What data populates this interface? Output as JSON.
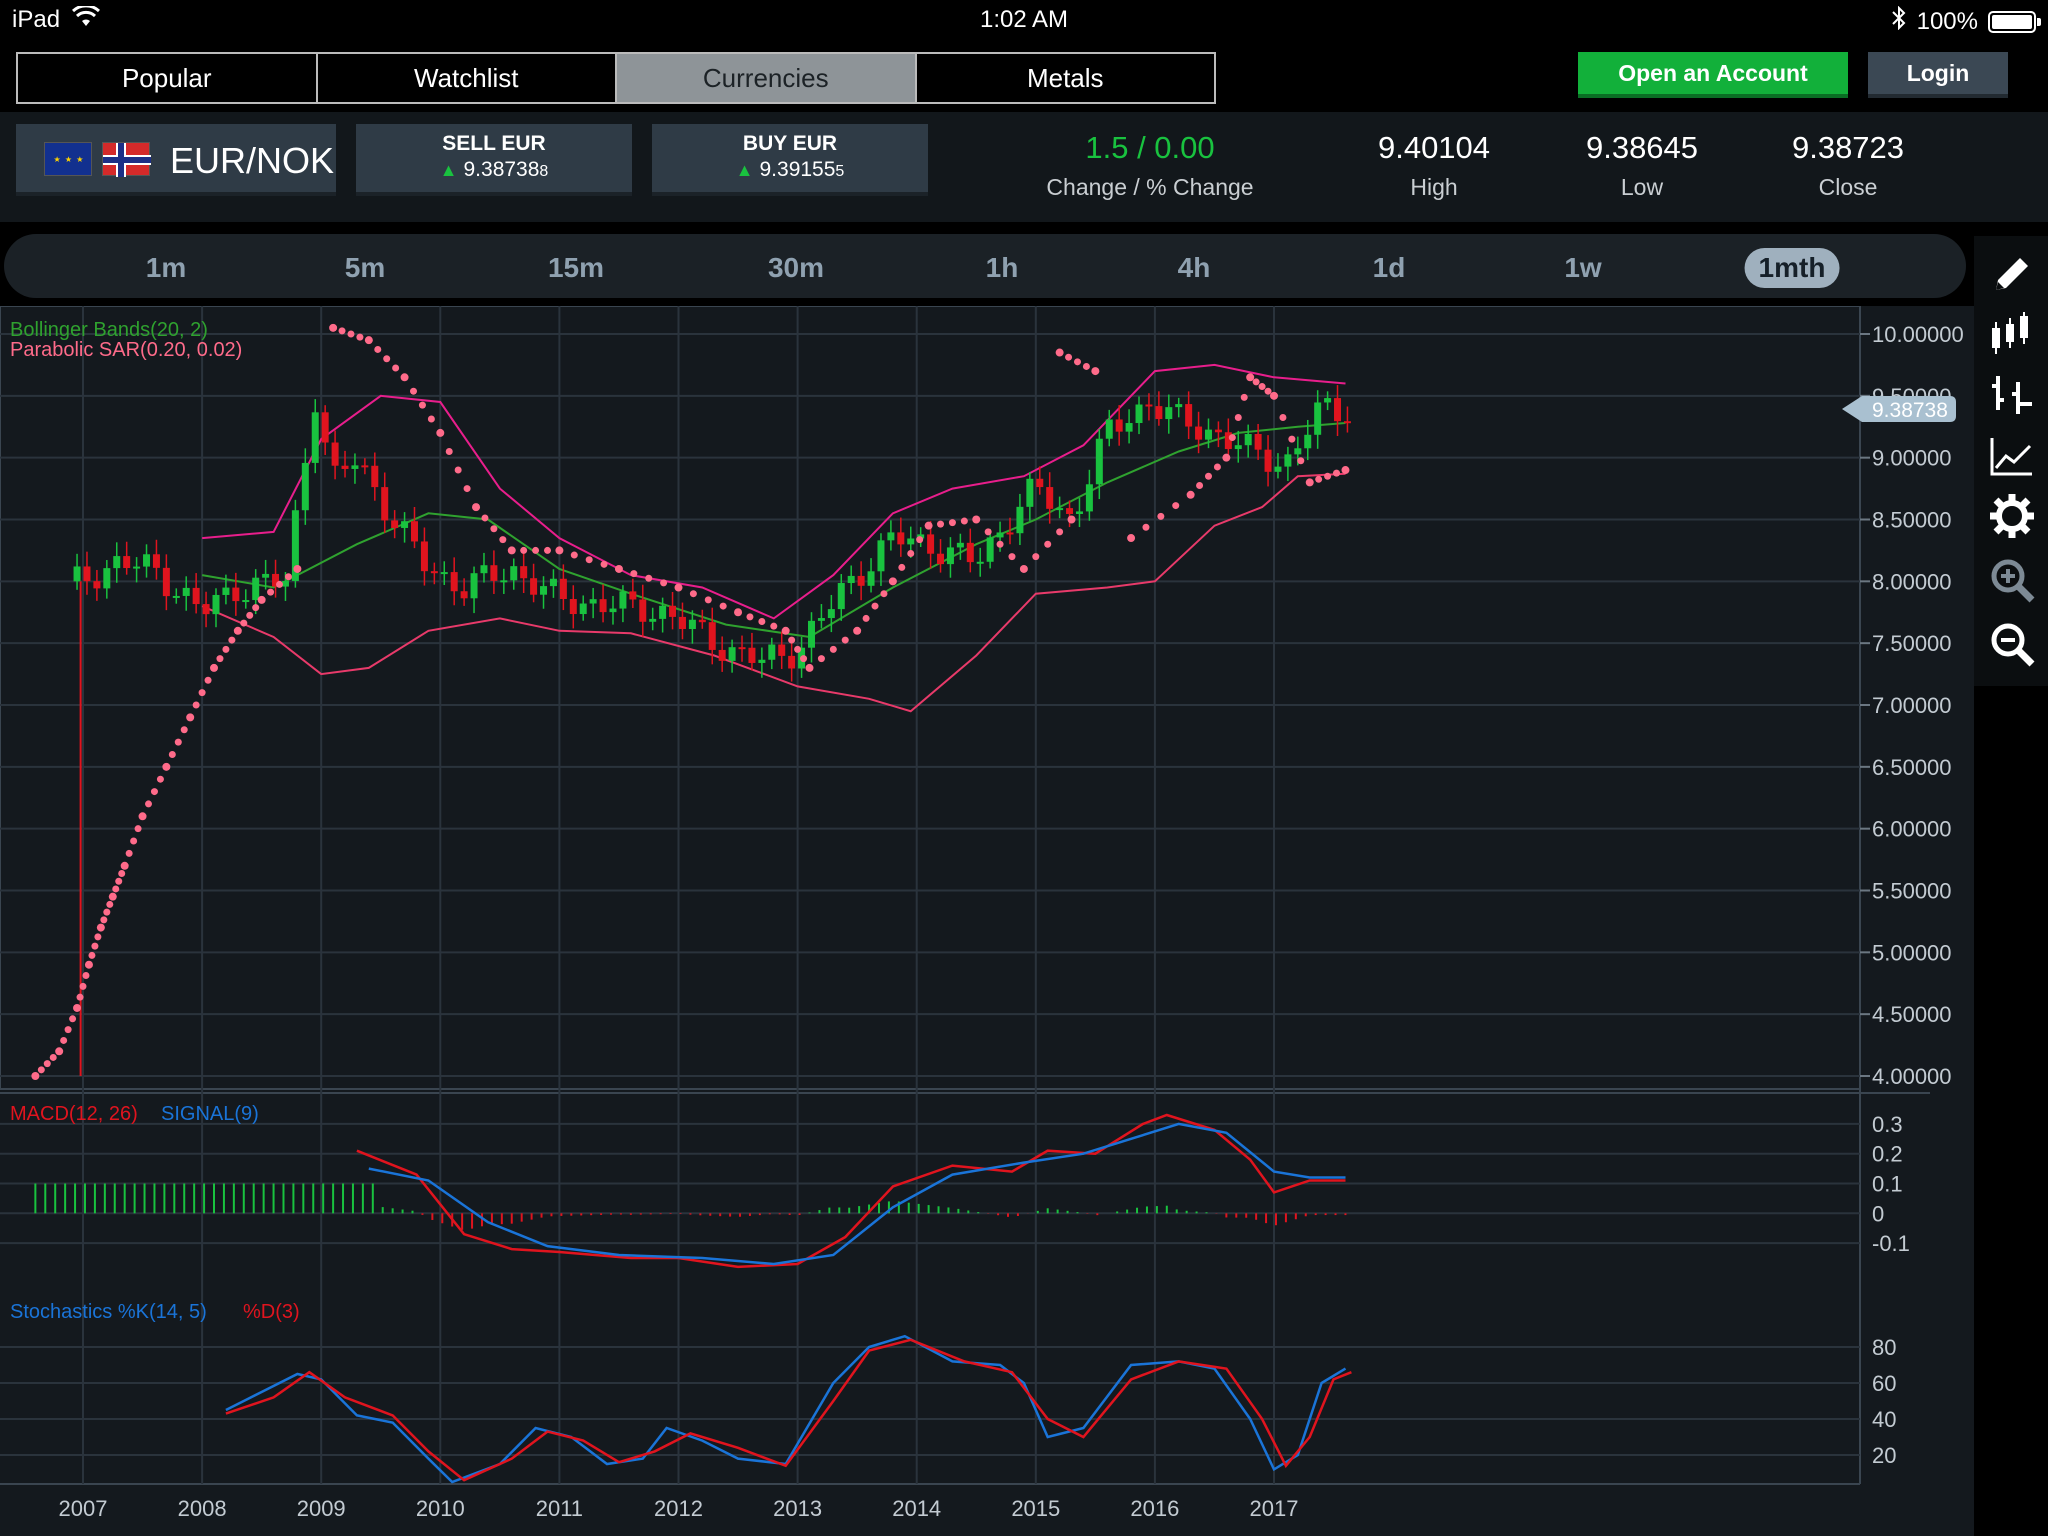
{
  "status_bar": {
    "device": "iPad",
    "time": "1:02 AM",
    "battery": "100%",
    "battery_level": 1.0
  },
  "tabs": [
    {
      "label": "Popular",
      "active": false
    },
    {
      "label": "Watchlist",
      "active": false
    },
    {
      "label": "Currencies",
      "active": true
    },
    {
      "label": "Metals",
      "active": false
    }
  ],
  "actions": {
    "open_account": "Open an Account",
    "login": "Login"
  },
  "instrument": {
    "pair": "EUR/NOK",
    "sell_label": "SELL EUR",
    "sell_price_main": "9.38738",
    "sell_price_sub": "8",
    "buy_label": "BUY EUR",
    "buy_price_main": "9.39155",
    "buy_price_sub": "5",
    "change": "1.5 / 0.00",
    "change_label": "Change / % Change",
    "high": "9.40104",
    "high_label": "High",
    "low": "9.38645",
    "low_label": "Low",
    "close": "9.38723",
    "close_label": "Close"
  },
  "timeframes": [
    {
      "label": "1m",
      "active": false
    },
    {
      "label": "5m",
      "active": false
    },
    {
      "label": "15m",
      "active": false
    },
    {
      "label": "30m",
      "active": false
    },
    {
      "label": "1h",
      "active": false
    },
    {
      "label": "4h",
      "active": false
    },
    {
      "label": "1d",
      "active": false
    },
    {
      "label": "1w",
      "active": false
    },
    {
      "label": "1mth",
      "active": true
    }
  ],
  "toolbar_icons": [
    "pencil-icon",
    "candlestick-icon",
    "ohlc-bars-icon",
    "line-chart-icon",
    "gear-icon",
    "zoom-in-icon",
    "zoom-out-icon"
  ],
  "colors": {
    "up": "#19c23f",
    "down": "#e0141e",
    "band_outer": "#e81e8c",
    "band_lower": "#e83a6a",
    "band_mid": "#2fa22f",
    "sar": "#ff6b8a",
    "macd": "#e0141e",
    "signal": "#1a74d8",
    "accent_green": "#12b03a"
  },
  "chart_data": [
    {
      "type": "candlestick",
      "indicators": [
        "Bollinger Bands(20, 2)",
        "Parabolic SAR(0.20, 0.02)"
      ],
      "current_price": "9.38738",
      "yticks": [
        "10.00000",
        "9.50000",
        "9.00000",
        "8.50000",
        "8.00000",
        "7.50000",
        "7.00000",
        "6.50000",
        "6.00000",
        "5.50000",
        "5.00000",
        "4.50000",
        "4.00000"
      ],
      "ylim": [
        4.0,
        10.0
      ],
      "x_ticks": [
        "2007",
        "2008",
        "2009",
        "2010",
        "2011",
        "2012",
        "2013",
        "2014",
        "2015",
        "2016",
        "2017"
      ],
      "close_series": [
        {
          "x": 2006.95,
          "y": 8.0
        },
        {
          "x": 2007.3,
          "y": 8.15
        },
        {
          "x": 2007.6,
          "y": 8.1
        },
        {
          "x": 2008.0,
          "y": 7.75
        },
        {
          "x": 2008.3,
          "y": 7.95
        },
        {
          "x": 2008.7,
          "y": 8.0
        },
        {
          "x": 2008.95,
          "y": 9.5
        },
        {
          "x": 2009.1,
          "y": 8.8
        },
        {
          "x": 2009.3,
          "y": 9.0
        },
        {
          "x": 2009.6,
          "y": 8.5
        },
        {
          "x": 2009.9,
          "y": 8.1
        },
        {
          "x": 2010.2,
          "y": 7.95
        },
        {
          "x": 2010.6,
          "y": 8.1
        },
        {
          "x": 2011.0,
          "y": 7.85
        },
        {
          "x": 2011.5,
          "y": 7.8
        },
        {
          "x": 2011.9,
          "y": 7.75
        },
        {
          "x": 2012.3,
          "y": 7.5
        },
        {
          "x": 2012.7,
          "y": 7.35
        },
        {
          "x": 2013.0,
          "y": 7.45
        },
        {
          "x": 2013.4,
          "y": 7.95
        },
        {
          "x": 2013.8,
          "y": 8.35
        },
        {
          "x": 2014.1,
          "y": 8.3
        },
        {
          "x": 2014.5,
          "y": 8.15
        },
        {
          "x": 2014.85,
          "y": 8.6
        },
        {
          "x": 2015.0,
          "y": 8.75
        },
        {
          "x": 2015.3,
          "y": 8.5
        },
        {
          "x": 2015.6,
          "y": 9.2
        },
        {
          "x": 2015.95,
          "y": 9.45
        },
        {
          "x": 2016.2,
          "y": 9.3
        },
        {
          "x": 2016.5,
          "y": 9.2
        },
        {
          "x": 2016.8,
          "y": 9.05
        },
        {
          "x": 2017.1,
          "y": 8.95
        },
        {
          "x": 2017.4,
          "y": 9.4
        },
        {
          "x": 2017.6,
          "y": 9.38
        }
      ],
      "bollinger_upper": [
        {
          "x": 2008.0,
          "y": 8.35
        },
        {
          "x": 2008.6,
          "y": 8.4
        },
        {
          "x": 2009.0,
          "y": 9.15
        },
        {
          "x": 2009.5,
          "y": 9.5
        },
        {
          "x": 2010.0,
          "y": 9.45
        },
        {
          "x": 2010.5,
          "y": 8.75
        },
        {
          "x": 2011.0,
          "y": 8.35
        },
        {
          "x": 2011.6,
          "y": 8.05
        },
        {
          "x": 2012.2,
          "y": 7.95
        },
        {
          "x": 2012.8,
          "y": 7.7
        },
        {
          "x": 2013.3,
          "y": 8.05
        },
        {
          "x": 2013.8,
          "y": 8.55
        },
        {
          "x": 2014.3,
          "y": 8.75
        },
        {
          "x": 2014.9,
          "y": 8.85
        },
        {
          "x": 2015.4,
          "y": 9.1
        },
        {
          "x": 2016.0,
          "y": 9.7
        },
        {
          "x": 2016.5,
          "y": 9.75
        },
        {
          "x": 2017.0,
          "y": 9.65
        },
        {
          "x": 2017.6,
          "y": 9.6
        }
      ],
      "bollinger_middle": [
        {
          "x": 2008.0,
          "y": 8.05
        },
        {
          "x": 2008.6,
          "y": 7.95
        },
        {
          "x": 2009.3,
          "y": 8.3
        },
        {
          "x": 2009.9,
          "y": 8.55
        },
        {
          "x": 2010.4,
          "y": 8.5
        },
        {
          "x": 2011.0,
          "y": 8.1
        },
        {
          "x": 2011.6,
          "y": 7.9
        },
        {
          "x": 2012.4,
          "y": 7.65
        },
        {
          "x": 2013.1,
          "y": 7.55
        },
        {
          "x": 2013.8,
          "y": 7.95
        },
        {
          "x": 2014.5,
          "y": 8.3
        },
        {
          "x": 2015.0,
          "y": 8.5
        },
        {
          "x": 2015.6,
          "y": 8.8
        },
        {
          "x": 2016.2,
          "y": 9.05
        },
        {
          "x": 2016.7,
          "y": 9.2
        },
        {
          "x": 2017.2,
          "y": 9.25
        },
        {
          "x": 2017.6,
          "y": 9.28
        }
      ],
      "bollinger_lower": [
        {
          "x": 2008.0,
          "y": 7.8
        },
        {
          "x": 2008.6,
          "y": 7.55
        },
        {
          "x": 2009.0,
          "y": 7.25
        },
        {
          "x": 2009.4,
          "y": 7.3
        },
        {
          "x": 2009.9,
          "y": 7.6
        },
        {
          "x": 2010.5,
          "y": 7.7
        },
        {
          "x": 2011.0,
          "y": 7.6
        },
        {
          "x": 2011.6,
          "y": 7.58
        },
        {
          "x": 2012.3,
          "y": 7.4
        },
        {
          "x": 2013.0,
          "y": 7.15
        },
        {
          "x": 2013.6,
          "y": 7.05
        },
        {
          "x": 2013.95,
          "y": 6.95
        },
        {
          "x": 2014.5,
          "y": 7.4
        },
        {
          "x": 2015.0,
          "y": 7.9
        },
        {
          "x": 2015.6,
          "y": 7.95
        },
        {
          "x": 2016.0,
          "y": 8.0
        },
        {
          "x": 2016.5,
          "y": 8.45
        },
        {
          "x": 2016.9,
          "y": 8.6
        },
        {
          "x": 2017.2,
          "y": 8.85
        },
        {
          "x": 2017.6,
          "y": 8.87
        }
      ],
      "parabolic_sar": [
        {
          "x": 2006.6,
          "y": 4.0
        },
        {
          "x": 2006.8,
          "y": 4.2
        },
        {
          "x": 2006.95,
          "y": 4.55
        },
        {
          "x": 2007.05,
          "y": 4.9
        },
        {
          "x": 2007.15,
          "y": 5.2
        },
        {
          "x": 2007.25,
          "y": 5.45
        },
        {
          "x": 2007.35,
          "y": 5.7
        },
        {
          "x": 2007.5,
          "y": 6.1
        },
        {
          "x": 2007.7,
          "y": 6.5
        },
        {
          "x": 2007.9,
          "y": 6.9
        },
        {
          "x": 2008.1,
          "y": 7.3
        },
        {
          "x": 2008.3,
          "y": 7.6
        },
        {
          "x": 2008.5,
          "y": 7.85
        },
        {
          "x": 2008.8,
          "y": 8.1
        },
        {
          "x": 2009.1,
          "y": 10.05
        },
        {
          "x": 2009.4,
          "y": 9.95
        },
        {
          "x": 2009.7,
          "y": 9.65
        },
        {
          "x": 2010.0,
          "y": 9.2
        },
        {
          "x": 2010.3,
          "y": 8.6
        },
        {
          "x": 2010.6,
          "y": 8.25
        },
        {
          "x": 2011.0,
          "y": 8.25
        },
        {
          "x": 2011.5,
          "y": 8.1
        },
        {
          "x": 2012.0,
          "y": 7.95
        },
        {
          "x": 2012.5,
          "y": 7.75
        },
        {
          "x": 2012.9,
          "y": 7.6
        },
        {
          "x": 2013.1,
          "y": 7.3
        },
        {
          "x": 2013.5,
          "y": 7.6
        },
        {
          "x": 2013.8,
          "y": 8.0
        },
        {
          "x": 2014.1,
          "y": 8.45
        },
        {
          "x": 2014.5,
          "y": 8.5
        },
        {
          "x": 2014.9,
          "y": 8.1
        },
        {
          "x": 2015.3,
          "y": 8.5
        },
        {
          "x": 2015.2,
          "y": 9.85
        },
        {
          "x": 2015.5,
          "y": 9.7
        },
        {
          "x": 2015.8,
          "y": 8.35
        },
        {
          "x": 2016.3,
          "y": 8.7
        },
        {
          "x": 2016.6,
          "y": 9.0
        },
        {
          "x": 2016.8,
          "y": 9.65
        },
        {
          "x": 2017.0,
          "y": 9.5
        },
        {
          "x": 2017.3,
          "y": 8.8
        },
        {
          "x": 2017.6,
          "y": 8.9
        }
      ]
    },
    {
      "type": "macd",
      "title_macd": "MACD(12, 26)",
      "title_signal": "SIGNAL(9)",
      "yticks": [
        "0.3",
        "0.2",
        "0.1",
        "0",
        "-0.1"
      ],
      "ylim": [
        -0.15,
        0.35
      ],
      "macd": [
        {
          "x": 2009.3,
          "y": 0.21
        },
        {
          "x": 2009.8,
          "y": 0.13
        },
        {
          "x": 2010.2,
          "y": -0.07
        },
        {
          "x": 2010.6,
          "y": -0.12
        },
        {
          "x": 2011.0,
          "y": -0.13
        },
        {
          "x": 2011.6,
          "y": -0.15
        },
        {
          "x": 2012.0,
          "y": -0.15
        },
        {
          "x": 2012.5,
          "y": -0.18
        },
        {
          "x": 2013.0,
          "y": -0.17
        },
        {
          "x": 2013.4,
          "y": -0.08
        },
        {
          "x": 2013.8,
          "y": 0.09
        },
        {
          "x": 2014.3,
          "y": 0.16
        },
        {
          "x": 2014.8,
          "y": 0.14
        },
        {
          "x": 2015.1,
          "y": 0.21
        },
        {
          "x": 2015.5,
          "y": 0.2
        },
        {
          "x": 2015.9,
          "y": 0.3
        },
        {
          "x": 2016.1,
          "y": 0.33
        },
        {
          "x": 2016.5,
          "y": 0.28
        },
        {
          "x": 2016.8,
          "y": 0.18
        },
        {
          "x": 2017.0,
          "y": 0.07
        },
        {
          "x": 2017.3,
          "y": 0.11
        },
        {
          "x": 2017.6,
          "y": 0.11
        }
      ],
      "signal": [
        {
          "x": 2009.4,
          "y": 0.15
        },
        {
          "x": 2009.9,
          "y": 0.11
        },
        {
          "x": 2010.4,
          "y": -0.03
        },
        {
          "x": 2010.9,
          "y": -0.11
        },
        {
          "x": 2011.5,
          "y": -0.14
        },
        {
          "x": 2012.2,
          "y": -0.15
        },
        {
          "x": 2012.8,
          "y": -0.17
        },
        {
          "x": 2013.3,
          "y": -0.14
        },
        {
          "x": 2013.8,
          "y": 0.02
        },
        {
          "x": 2014.3,
          "y": 0.13
        },
        {
          "x": 2014.9,
          "y": 0.17
        },
        {
          "x": 2015.4,
          "y": 0.2
        },
        {
          "x": 2015.8,
          "y": 0.25
        },
        {
          "x": 2016.2,
          "y": 0.3
        },
        {
          "x": 2016.6,
          "y": 0.27
        },
        {
          "x": 2017.0,
          "y": 0.14
        },
        {
          "x": 2017.3,
          "y": 0.12
        },
        {
          "x": 2017.6,
          "y": 0.12
        }
      ]
    },
    {
      "type": "stochastics",
      "title_k": "Stochastics %K(14, 5)",
      "title_d": "%D(3)",
      "yticks": [
        "80",
        "60",
        "40",
        "20"
      ],
      "ylim": [
        0,
        100
      ],
      "k": [
        {
          "x": 2008.2,
          "y": 45
        },
        {
          "x": 2008.5,
          "y": 55
        },
        {
          "x": 2008.8,
          "y": 65
        },
        {
          "x": 2009.0,
          "y": 62
        },
        {
          "x": 2009.3,
          "y": 42
        },
        {
          "x": 2009.6,
          "y": 38
        },
        {
          "x": 2009.9,
          "y": 18
        },
        {
          "x": 2010.1,
          "y": 5
        },
        {
          "x": 2010.5,
          "y": 15
        },
        {
          "x": 2010.8,
          "y": 35
        },
        {
          "x": 2011.1,
          "y": 30
        },
        {
          "x": 2011.4,
          "y": 15
        },
        {
          "x": 2011.7,
          "y": 18
        },
        {
          "x": 2011.9,
          "y": 35
        },
        {
          "x": 2012.2,
          "y": 28
        },
        {
          "x": 2012.5,
          "y": 18
        },
        {
          "x": 2012.9,
          "y": 15
        },
        {
          "x": 2013.3,
          "y": 60
        },
        {
          "x": 2013.6,
          "y": 80
        },
        {
          "x": 2013.9,
          "y": 86
        },
        {
          "x": 2014.3,
          "y": 72
        },
        {
          "x": 2014.7,
          "y": 70
        },
        {
          "x": 2014.9,
          "y": 60
        },
        {
          "x": 2015.1,
          "y": 30
        },
        {
          "x": 2015.4,
          "y": 35
        },
        {
          "x": 2015.8,
          "y": 70
        },
        {
          "x": 2016.2,
          "y": 72
        },
        {
          "x": 2016.5,
          "y": 68
        },
        {
          "x": 2016.8,
          "y": 40
        },
        {
          "x": 2017.0,
          "y": 12
        },
        {
          "x": 2017.2,
          "y": 20
        },
        {
          "x": 2017.4,
          "y": 60
        },
        {
          "x": 2017.6,
          "y": 68
        }
      ],
      "d": [
        {
          "x": 2008.2,
          "y": 43
        },
        {
          "x": 2008.6,
          "y": 52
        },
        {
          "x": 2008.9,
          "y": 66
        },
        {
          "x": 2009.2,
          "y": 52
        },
        {
          "x": 2009.6,
          "y": 42
        },
        {
          "x": 2009.9,
          "y": 22
        },
        {
          "x": 2010.2,
          "y": 6
        },
        {
          "x": 2010.6,
          "y": 18
        },
        {
          "x": 2010.9,
          "y": 33
        },
        {
          "x": 2011.2,
          "y": 28
        },
        {
          "x": 2011.5,
          "y": 16
        },
        {
          "x": 2011.8,
          "y": 22
        },
        {
          "x": 2012.1,
          "y": 32
        },
        {
          "x": 2012.5,
          "y": 24
        },
        {
          "x": 2012.9,
          "y": 14
        },
        {
          "x": 2013.3,
          "y": 50
        },
        {
          "x": 2013.6,
          "y": 78
        },
        {
          "x": 2013.95,
          "y": 84
        },
        {
          "x": 2014.4,
          "y": 72
        },
        {
          "x": 2014.8,
          "y": 66
        },
        {
          "x": 2015.1,
          "y": 40
        },
        {
          "x": 2015.4,
          "y": 30
        },
        {
          "x": 2015.8,
          "y": 62
        },
        {
          "x": 2016.2,
          "y": 72
        },
        {
          "x": 2016.6,
          "y": 68
        },
        {
          "x": 2016.9,
          "y": 40
        },
        {
          "x": 2017.1,
          "y": 14
        },
        {
          "x": 2017.3,
          "y": 30
        },
        {
          "x": 2017.5,
          "y": 62
        },
        {
          "x": 2017.65,
          "y": 66
        }
      ]
    }
  ]
}
